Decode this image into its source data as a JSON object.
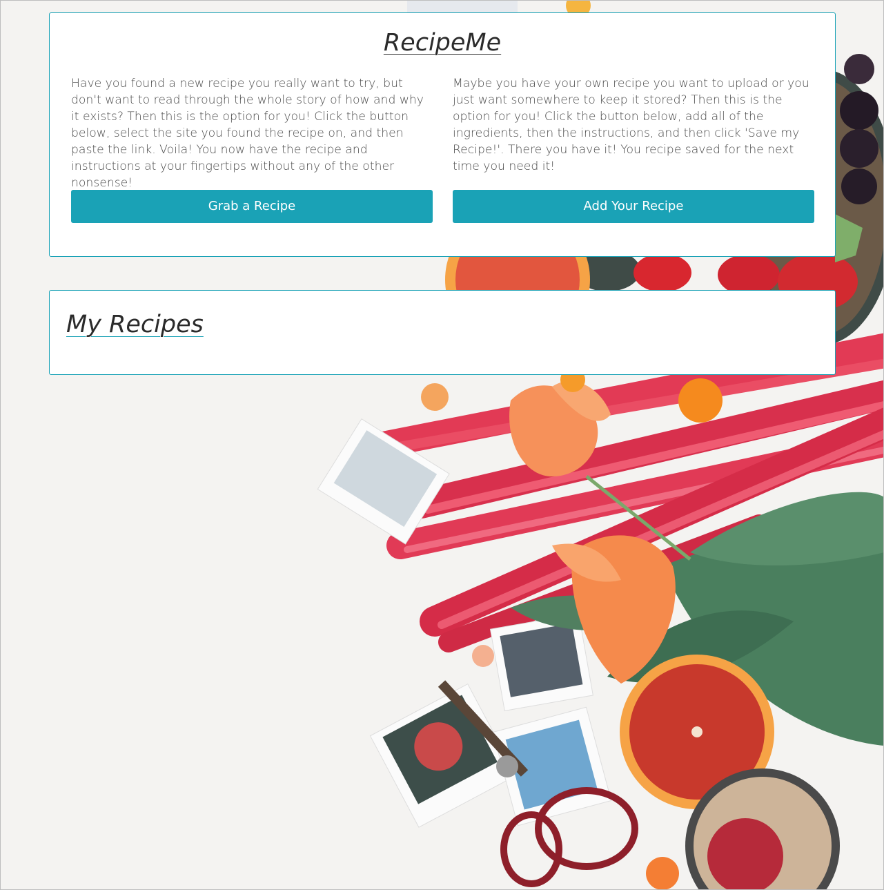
{
  "header": {
    "title": "RecipeMe"
  },
  "grab_section": {
    "description": "Have you found a new recipe you really want to try, but don't want to read through the whole story of how and why it exists? Then this is the option for you! Click the button below, select the site you found the recipe on, and then paste the link. Voila! You now have the recipe and instructions at your fingertips without any of the other nonsense!",
    "button_label": "Grab a Recipe"
  },
  "add_section": {
    "description": "Maybe you have your own recipe you want to upload or you just want somewhere to keep it stored? Then this is the option for you! Click the button below, add all of the ingredients, then the instructions, and then click 'Save my Recipe!'. There you have it! You recipe saved for the next time you need it!",
    "button_label": "Add Your Recipe"
  },
  "my_recipes": {
    "title": "My Recipes"
  },
  "colors": {
    "accent": "#1aa2b6",
    "card_background": "#ffffff",
    "body_text": "#4a4a4a",
    "heading_text": "#2b2b2b"
  }
}
